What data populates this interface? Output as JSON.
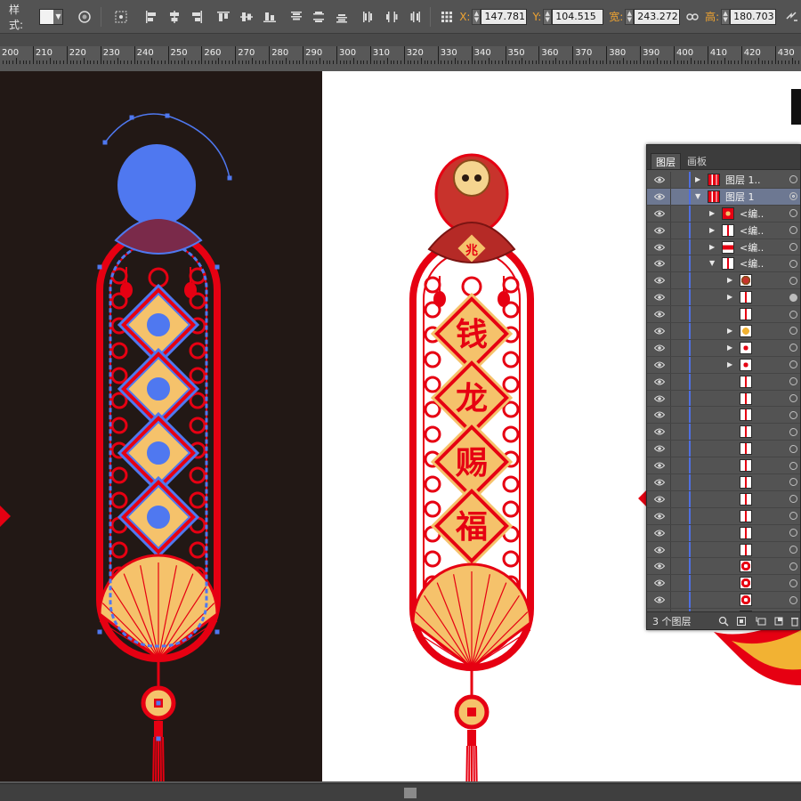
{
  "control_bar": {
    "style_label": "样式:",
    "x_label": "X:",
    "x_value": "147.781",
    "y_label": "Y:",
    "y_value": "104.515",
    "w_label": "宽:",
    "w_value": "243.272",
    "h_label": "高:",
    "h_value": "180.703",
    "label_color": "#f0a431"
  },
  "ruler": {
    "labels": [
      "200",
      "210",
      "220",
      "230",
      "240",
      "250",
      "260",
      "270",
      "280",
      "290",
      "300",
      "310",
      "320",
      "330",
      "340",
      "350",
      "360",
      "370",
      "380",
      "390",
      "400",
      "410",
      "420",
      "430"
    ]
  },
  "artwork": {
    "white_text": [
      "钱",
      "龙",
      "赐",
      "福"
    ],
    "bag_text": "兆",
    "red": "#e60012",
    "gold": "#f5c26b",
    "selection_blue": "#4f78f0"
  },
  "layers_panel": {
    "tabs": [
      "图层",
      "画板"
    ],
    "rows": [
      {
        "name": "图层 1..",
        "indent": 0,
        "twirl": "right",
        "thumb": "multi",
        "selected": false,
        "target": "hollow"
      },
      {
        "name": "图层 1",
        "indent": 0,
        "twirl": "down",
        "thumb": "multi",
        "selected": true,
        "target": "double"
      },
      {
        "name": "<编..",
        "indent": 1,
        "twirl": "right",
        "thumb": "flower",
        "selected": false,
        "target": "hollow"
      },
      {
        "name": "<编..",
        "indent": 1,
        "twirl": "right",
        "thumb": "strip",
        "selected": false,
        "target": "hollow"
      },
      {
        "name": "<编..",
        "indent": 1,
        "twirl": "right",
        "thumb": "band",
        "selected": false,
        "target": "hollow"
      },
      {
        "name": "<编..",
        "indent": 1,
        "twirl": "down",
        "thumb": "strip",
        "selected": false,
        "target": "hollow"
      },
      {
        "name": "",
        "indent": 2,
        "twirl": "right",
        "thumb": "figure",
        "selected": false,
        "target": "hollow"
      },
      {
        "name": "",
        "indent": 2,
        "twirl": "right",
        "thumb": "strip",
        "selected": false,
        "target": "filled"
      },
      {
        "name": "",
        "indent": 2,
        "twirl": "none",
        "thumb": "strip",
        "selected": false,
        "target": "hollow"
      },
      {
        "name": "",
        "indent": 2,
        "twirl": "right",
        "thumb": "gold",
        "selected": false,
        "target": "hollow"
      },
      {
        "name": "",
        "indent": 2,
        "twirl": "right",
        "thumb": "dot",
        "selected": false,
        "target": "hollow"
      },
      {
        "name": "",
        "indent": 2,
        "twirl": "right",
        "thumb": "dot",
        "selected": false,
        "target": "hollow"
      },
      {
        "name": "",
        "indent": 2,
        "twirl": "none",
        "thumb": "strip",
        "selected": false,
        "target": "hollow"
      },
      {
        "name": "",
        "indent": 2,
        "twirl": "none",
        "thumb": "strip",
        "selected": false,
        "target": "hollow"
      },
      {
        "name": "",
        "indent": 2,
        "twirl": "none",
        "thumb": "strip",
        "selected": false,
        "target": "hollow"
      },
      {
        "name": "",
        "indent": 2,
        "twirl": "none",
        "thumb": "strip",
        "selected": false,
        "target": "hollow"
      },
      {
        "name": "",
        "indent": 2,
        "twirl": "none",
        "thumb": "strip",
        "selected": false,
        "target": "hollow"
      },
      {
        "name": "",
        "indent": 2,
        "twirl": "none",
        "thumb": "strip",
        "selected": false,
        "target": "hollow"
      },
      {
        "name": "",
        "indent": 2,
        "twirl": "none",
        "thumb": "strip",
        "selected": false,
        "target": "hollow"
      },
      {
        "name": "",
        "indent": 2,
        "twirl": "none",
        "thumb": "strip",
        "selected": false,
        "target": "hollow"
      },
      {
        "name": "",
        "indent": 2,
        "twirl": "none",
        "thumb": "strip",
        "selected": false,
        "target": "hollow"
      },
      {
        "name": "",
        "indent": 2,
        "twirl": "none",
        "thumb": "strip",
        "selected": false,
        "target": "hollow"
      },
      {
        "name": "",
        "indent": 2,
        "twirl": "none",
        "thumb": "strip",
        "selected": false,
        "target": "hollow"
      },
      {
        "name": "",
        "indent": 2,
        "twirl": "none",
        "thumb": "diamond",
        "selected": false,
        "target": "hollow"
      },
      {
        "name": "",
        "indent": 2,
        "twirl": "none",
        "thumb": "diamond",
        "selected": false,
        "target": "hollow"
      },
      {
        "name": "",
        "indent": 2,
        "twirl": "none",
        "thumb": "diamond",
        "selected": false,
        "target": "hollow"
      },
      {
        "name": "",
        "indent": 2,
        "twirl": "right",
        "thumb": "strip",
        "selected": false,
        "target": "hollow"
      }
    ],
    "footer_count": "3 个图层"
  }
}
